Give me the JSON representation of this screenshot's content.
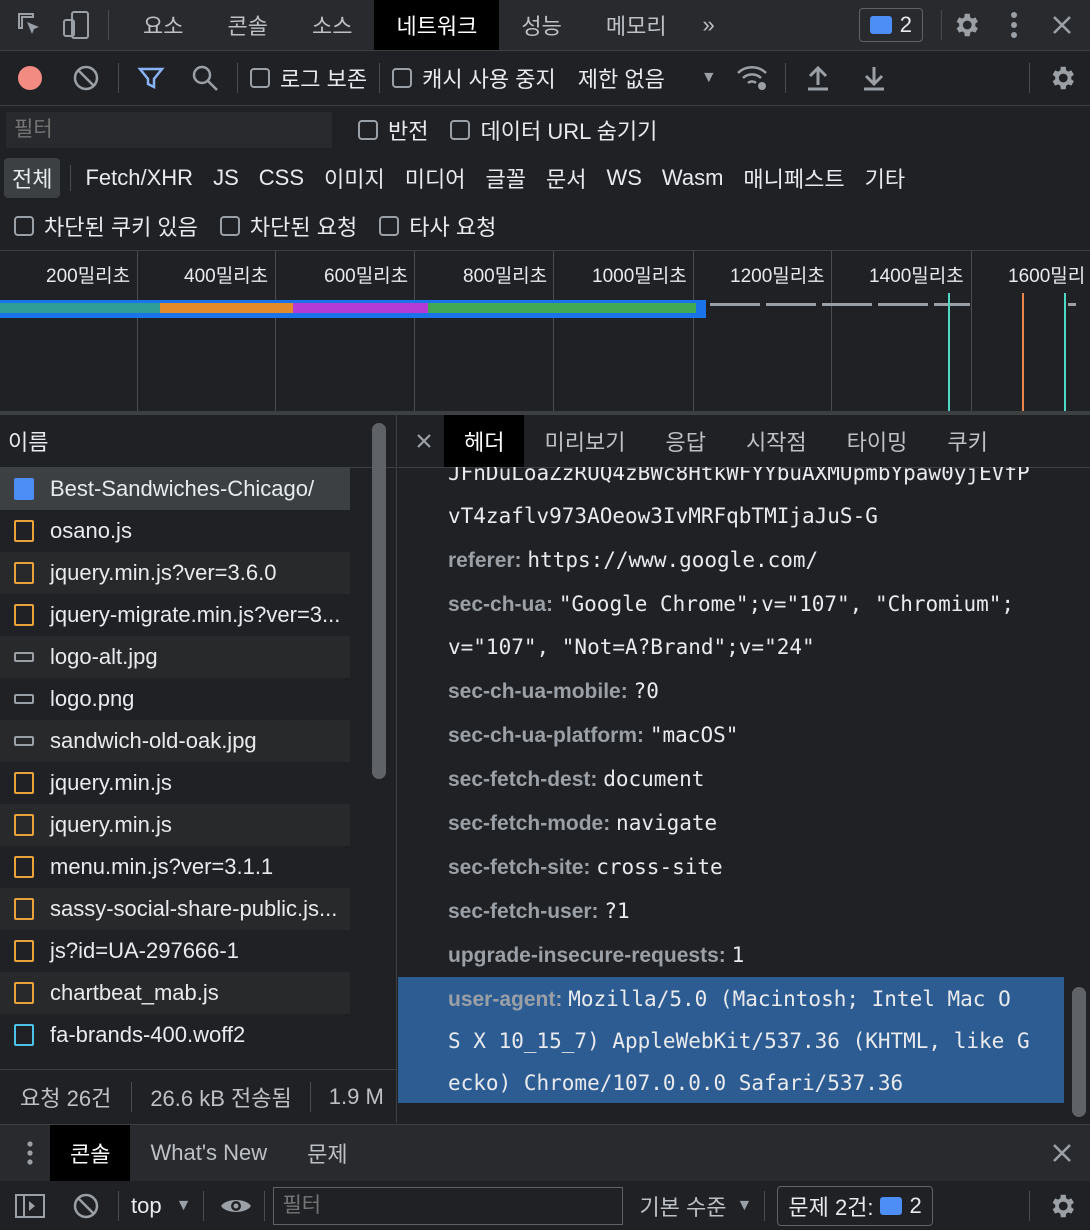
{
  "top_tabs": [
    "요소",
    "콘솔",
    "소스",
    "네트워크",
    "성능",
    "메모리"
  ],
  "top_active": "네트워크",
  "issues_count": "2",
  "toolbar": {
    "preserve_log": "로그 보존",
    "disable_cache": "캐시 사용 중지",
    "throttle": "제한 없음"
  },
  "filter": {
    "placeholder": "필터",
    "invert": "반전",
    "hide_data_urls": "데이터 URL 숨기기"
  },
  "type_filters": [
    "전체",
    "Fetch/XHR",
    "JS",
    "CSS",
    "이미지",
    "미디어",
    "글꼴",
    "문서",
    "WS",
    "Wasm",
    "매니페스트",
    "기타"
  ],
  "cookie_filters": {
    "blocked_cookies": "차단된 쿠키 있음",
    "blocked_requests": "차단된 요청",
    "third_party": "타사 요청"
  },
  "timeline_ticks": [
    "200밀리초",
    "400밀리초",
    "600밀리초",
    "800밀리초",
    "1000밀리초",
    "1200밀리초",
    "1400밀리초",
    "1600밀리"
  ],
  "colors": {
    "waiting": "#2e9e96",
    "dns": "#e48a2b",
    "ssl": "#b43bd6",
    "download": "#41a854",
    "accent": "#1a73e8"
  },
  "list": {
    "header": "이름",
    "items": [
      {
        "name": "Best-Sandwiches-Chicago/",
        "type": "doc"
      },
      {
        "name": "osano.js",
        "type": "js"
      },
      {
        "name": "jquery.min.js?ver=3.6.0",
        "type": "js"
      },
      {
        "name": "jquery-migrate.min.js?ver=3...",
        "type": "js"
      },
      {
        "name": "logo-alt.jpg",
        "type": "img"
      },
      {
        "name": "logo.png",
        "type": "img"
      },
      {
        "name": "sandwich-old-oak.jpg",
        "type": "img"
      },
      {
        "name": "jquery.min.js",
        "type": "js"
      },
      {
        "name": "jquery.min.js",
        "type": "js"
      },
      {
        "name": "menu.min.js?ver=3.1.1",
        "type": "js"
      },
      {
        "name": "sassy-social-share-public.js...",
        "type": "js"
      },
      {
        "name": "js?id=UA-297666-1",
        "type": "js"
      },
      {
        "name": "chartbeat_mab.js",
        "type": "js"
      },
      {
        "name": "fa-brands-400.woff2",
        "type": "font"
      }
    ]
  },
  "status": {
    "requests": "요청 26건",
    "transferred": "26.6 kB 전송됨",
    "resources": "1.9 M"
  },
  "detail_tabs": [
    "헤더",
    "미리보기",
    "응답",
    "시작점",
    "타이밍",
    "쿠키"
  ],
  "headers": {
    "cont1": "JFnDuLoaZzRUQ4zBWc8HtkWFYYbuAXMUpmbYpaw0yjEVfP",
    "cont2": "vT4zaflv973AOeow3IvMRFqbTMIjaJuS-G",
    "referer_k": "referer:",
    "referer_v": "https://www.google.com/",
    "ua_k": "sec-ch-ua:",
    "ua_v1": "\"Google Chrome\";v=\"107\", \"Chromium\";",
    "ua_v2": "v=\"107\", \"Not=A?Brand\";v=\"24\"",
    "mobile_k": "sec-ch-ua-mobile:",
    "mobile_v": "?0",
    "platform_k": "sec-ch-ua-platform:",
    "platform_v": "\"macOS\"",
    "dest_k": "sec-fetch-dest:",
    "dest_v": "document",
    "mode_k": "sec-fetch-mode:",
    "mode_v": "navigate",
    "site_k": "sec-fetch-site:",
    "site_v": "cross-site",
    "user_k": "sec-fetch-user:",
    "user_v": "?1",
    "upgrade_k": "upgrade-insecure-requests:",
    "upgrade_v": "1",
    "agent_k": "user-agent:",
    "agent_v1": "Mozilla/5.0 (Macintosh; Intel Mac O",
    "agent_v2": "S X 10_15_7) AppleWebKit/537.36 (KHTML, like G",
    "agent_v3": "ecko) Chrome/107.0.0.0 Safari/537.36"
  },
  "drawer": {
    "tabs": [
      "콘솔",
      "What's New",
      "문제"
    ],
    "context": "top",
    "filter_placeholder": "필터",
    "level": "기본 수준",
    "issues_label": "문제 2건:",
    "issues_count": "2"
  }
}
